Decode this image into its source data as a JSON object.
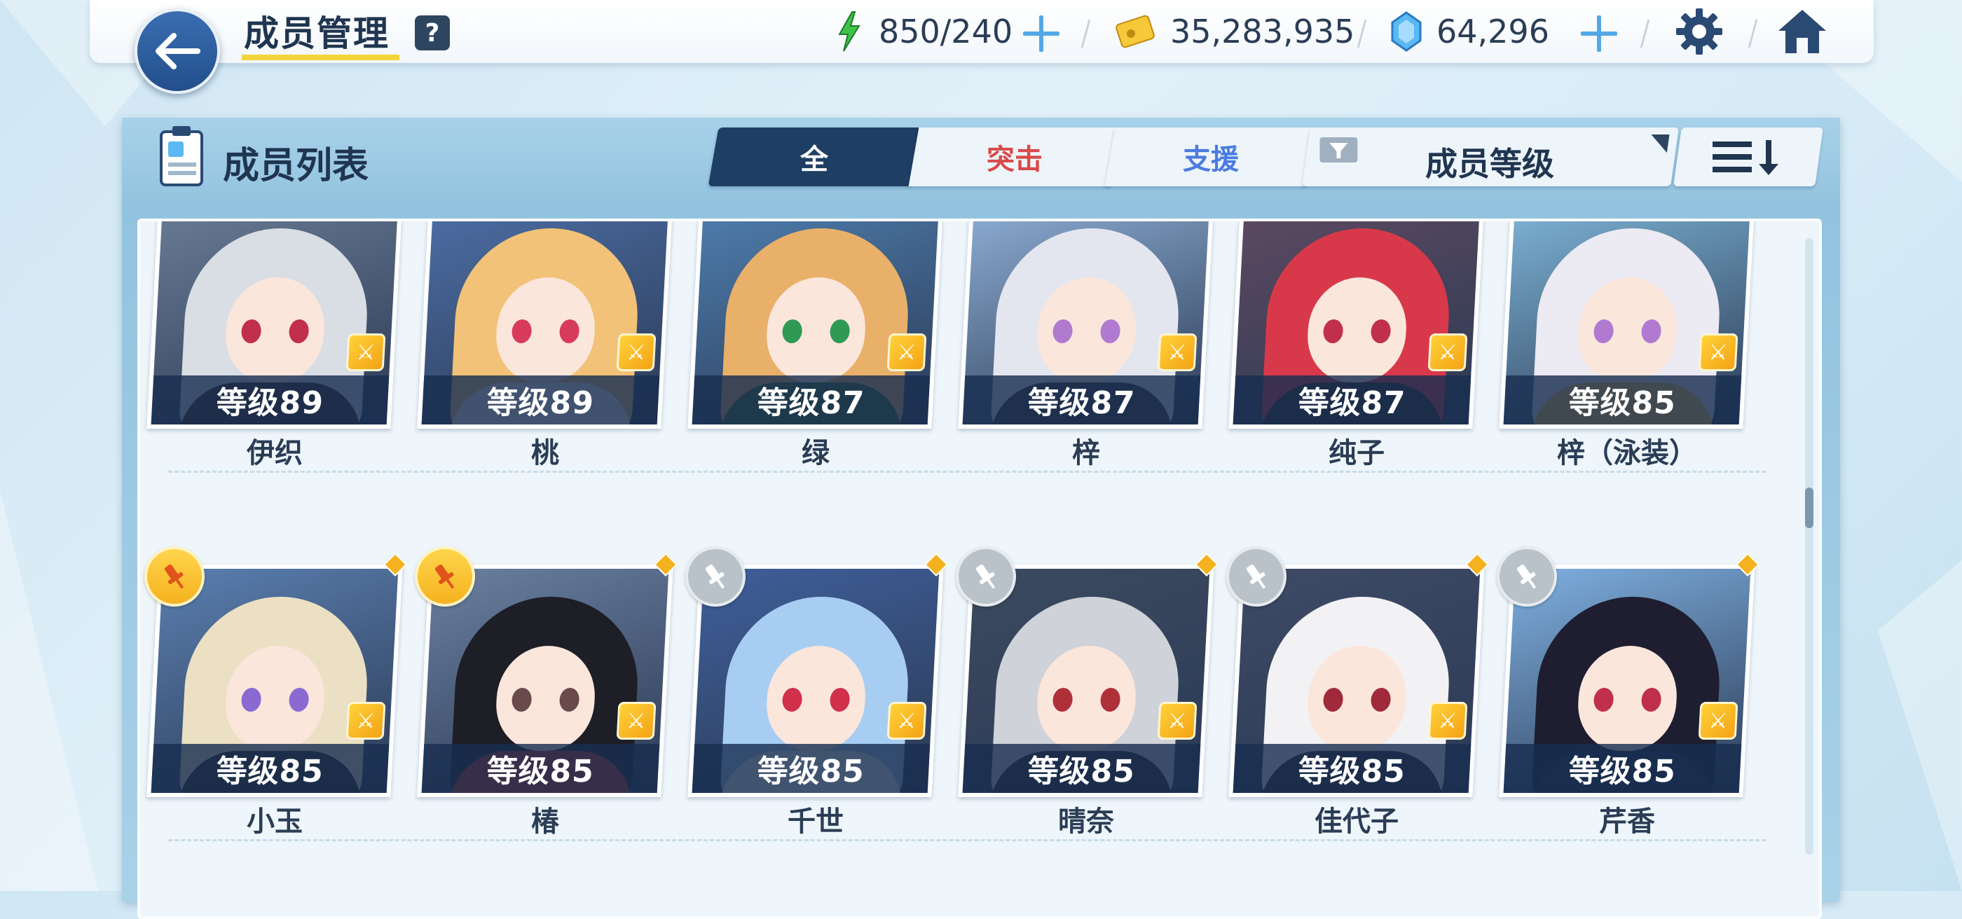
{
  "header": {
    "title": "成员管理",
    "help_label": "?",
    "stamina": "850/240",
    "credits": "35,283,935",
    "pyroxene": "64,296"
  },
  "panel": {
    "title": "成员列表",
    "tabs": [
      {
        "label": "全",
        "selected": true
      },
      {
        "label": "突击",
        "selected": false
      },
      {
        "label": "支援",
        "selected": false
      }
    ],
    "sort_by": "成员等级"
  },
  "students": [
    {
      "name": "伊织",
      "level": "等级89",
      "hair": "#d9dde4",
      "outfit": "#3a2a2a",
      "eye": "#c0304a",
      "bg": "#6b7d96",
      "pinned": null
    },
    {
      "name": "桃",
      "level": "等级89",
      "hair": "#f1c277",
      "outfit": "#f2f2f2",
      "eye": "#d83a5c",
      "bg": "#4d6fa6",
      "pinned": null
    },
    {
      "name": "绿",
      "level": "等级87",
      "hair": "#e9b06a",
      "outfit": "#3f6a3a",
      "eye": "#2f9a54",
      "bg": "#4f7fb0",
      "pinned": null
    },
    {
      "name": "梓",
      "level": "等级87",
      "hair": "#e4e6ef",
      "outfit": "#3a3a44",
      "eye": "#b07ad0",
      "bg": "#8fb0d6",
      "pinned": null
    },
    {
      "name": "纯子",
      "level": "等级87",
      "hair": "#d8394a",
      "outfit": "#2f2a2e",
      "eye": "#c0304a",
      "bg": "#5e4a60",
      "pinned": null
    },
    {
      "name": "梓（泳装）",
      "level": "等级85",
      "hair": "#eceaf2",
      "outfit": "#f3c24a",
      "eye": "#b07ad0",
      "bg": "#7fb6d8",
      "pinned": null
    },
    {
      "name": "小玉",
      "level": "等级85",
      "hair": "#ece0c4",
      "outfit": "#2a2a2a",
      "eye": "#8a6ad0",
      "bg": "#5a7fb0",
      "pinned": "active"
    },
    {
      "name": "椿",
      "level": "等级85",
      "hair": "#1e1e26",
      "outfit": "#c43030",
      "eye": "#6a4a4a",
      "bg": "#6a7fa0",
      "pinned": "active"
    },
    {
      "name": "千世",
      "level": "等级85",
      "hair": "#a8cdf2",
      "outfit": "#f4f6fa",
      "eye": "#d0304a",
      "bg": "#3f5f9a",
      "pinned": "inactive"
    },
    {
      "name": "晴奈",
      "level": "等级85",
      "hair": "#cfd2d8",
      "outfit": "#2a2a2e",
      "eye": "#b0303a",
      "bg": "#3c4a60",
      "pinned": "inactive"
    },
    {
      "name": "佳代子",
      "level": "等级85",
      "hair": "#f2f2f4",
      "outfit": "#2a2a2e",
      "eye": "#a02a3a",
      "bg": "#3e4a66",
      "pinned": "inactive"
    },
    {
      "name": "芹香",
      "level": "等级85",
      "hair": "#1e1e30",
      "outfit": "#1e2a44",
      "eye": "#c0304a",
      "bg": "#7fb0e0",
      "pinned": "inactive"
    }
  ],
  "colors": {
    "accent": "#1e3f63",
    "striker": "#d94a4a",
    "special": "#4a7be0",
    "gold": "#f5b21f"
  },
  "icons": [
    "back-arrow-icon",
    "stamina-bolt-icon",
    "credit-card-icon",
    "pyroxene-gem-icon",
    "gear-icon",
    "home-icon",
    "filter-icon",
    "sort-order-icon",
    "pin-icon",
    "weapon-role-icon",
    "member-list-icon"
  ]
}
